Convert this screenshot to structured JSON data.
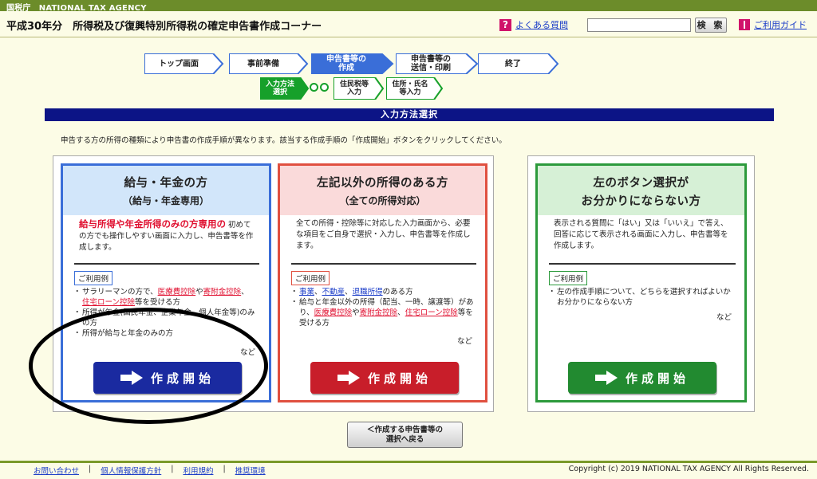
{
  "topbar": {
    "label": "国税庁　NATIONAL TAX AGENCY"
  },
  "header": {
    "title": "平成30年分　所得税及び復興特別所得税の確定申告書作成コーナー",
    "faq_label": "よくある質問",
    "search_button": "検 索",
    "search_placeholder": "",
    "guide_label": "ご利用ガイド"
  },
  "steps": [
    {
      "label": "トップ画面"
    },
    {
      "label": "事前準備"
    },
    {
      "label": "申告書等の\n作成"
    },
    {
      "label": "申告書等の\n送信・印刷"
    },
    {
      "label": "終了"
    }
  ],
  "substeps": [
    {
      "label": "入力方法\n選択"
    },
    {
      "label": "住民税等\n入力"
    },
    {
      "label": "住所・氏名\n等入力"
    }
  ],
  "section_title": "入力方法選択",
  "instruction": "申告する方の所得の種類により申告書の作成手順が異なります。該当する作成手順の「作成開始」ボタンをクリックしてください。",
  "cards": {
    "salary": {
      "title": "給与・年金の方",
      "subtitle": "（給与・年金専用）",
      "highlight": "給与所得や年金所得のみの方専用の",
      "desc": "初めての方でも操作しやすい画面に入力し、申告書等を作成します。",
      "usage_label": "ご利用例",
      "u1_a": "サラリーマンの方で、",
      "u1_b": "医療費控除",
      "u1_c": "や",
      "u1_d": "寄附金控除",
      "u1_e": "、",
      "u1_f": "住宅ローン控除",
      "u1_g": "等を受ける方",
      "u2": "所得が年金(国民年金、企業年金、個人年金等)のみの方",
      "u3": "所得が給与と年金のみの方",
      "nado": "など",
      "button": "作成開始"
    },
    "other": {
      "title": "左記以外の所得のある方",
      "subtitle": "（全ての所得対応）",
      "desc": "全ての所得・控除等に対応した入力画面から、必要な項目をご自身で選択・入力し、申告書等を作成します。",
      "usage_label": "ご利用例",
      "u1_a": "事業",
      "u1_b": "、",
      "u1_c": "不動産",
      "u1_d": "、",
      "u1_e": "退職所得",
      "u1_f": "のある方",
      "u2_a": "給与と年金以外の所得（配当、一時、譲渡等）があり、",
      "u2_b": "医療費控除",
      "u2_c": "や",
      "u2_d": "寄附金控除",
      "u2_e": "、",
      "u2_f": "住宅ローン控除",
      "u2_g": "等を受ける方",
      "nado": "など",
      "button": "作成開始"
    },
    "unsure": {
      "title": "左のボタン選択が",
      "title2": "お分かりにならない方",
      "desc": "表示される質問に「はい」又は「いいえ」で答え、回答に応じて表示される画面に入力し、申告書等を作成します。",
      "usage_label": "ご利用例",
      "u1": "左の作成手順について、どちらを選択すればよいかお分かりにならない方",
      "nado": "など",
      "button": "作成開始"
    }
  },
  "back_button": "＜作成する申告書等の\n選択へ戻る",
  "footer": {
    "links": [
      "お問い合わせ",
      "個人情報保護方針",
      "利用規約",
      "推奨環境"
    ],
    "copyright": "Copyright (c) 2019 NATIONAL TAX AGENCY All Rights Reserved."
  },
  "colors": {
    "blue_card": "#3a6ed8",
    "red_card": "#e05040",
    "green_card": "#2c9a3c",
    "blue_button": "#1a2aa0",
    "red_button": "#c81e2a",
    "green_button": "#228a30",
    "section_bar": "#0c1486"
  }
}
